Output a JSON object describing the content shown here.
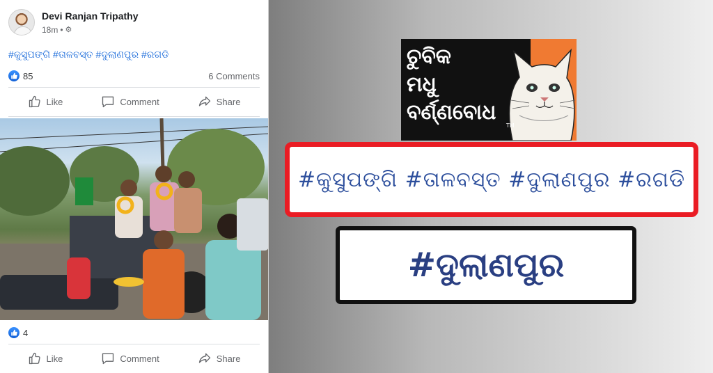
{
  "post": {
    "author": "Devi Ranjan Tripathy",
    "time": "18m",
    "separator": "•",
    "privacy_icon": "gear-icon",
    "hashtags": "#କୁସୁପଙ୍ଗି #ତାଳବସ୍ତ #ଦୁଲାଣପୁର #ରଗଡି",
    "reactions_count": "85",
    "comments_label": "6 Comments",
    "actions": {
      "like": "Like",
      "comment": "Comment",
      "share": "Share"
    },
    "photo_reactions_count": "4"
  },
  "collage": {
    "magazine": {
      "title_line1": "ଚୁବିକ",
      "title_line2": "ମଧୁ",
      "title_line3": "ବର୍ଣ୍ଣବୋଧ",
      "tm": "TM"
    },
    "red_box_text": "#କୁସୁପଙ୍ଗି #ତାଳବସ୍ତ #ଦୁଲାଣପୁର #ରଗଡି",
    "black_box_text": "#ଦୁଲାଣପୁର"
  },
  "colors": {
    "fb_link": "#216fdb",
    "fb_gray": "#65676b",
    "red_border": "#ea1c24",
    "black_border": "#111111",
    "hashtag_blue": "#2c4e9c",
    "magazine_orange": "#f07a32"
  }
}
